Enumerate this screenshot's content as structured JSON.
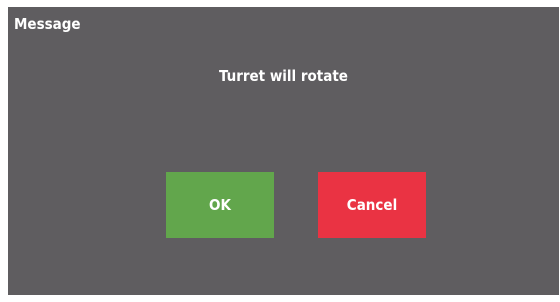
{
  "dialog": {
    "title": "Message",
    "message": "Turret will rotate",
    "ok_label": "OK",
    "cancel_label": "Cancel"
  },
  "colors": {
    "dialog_background": "#5f5d60",
    "ok_button": "#62a64c",
    "cancel_button": "#ea3343",
    "text": "#ffffff"
  }
}
